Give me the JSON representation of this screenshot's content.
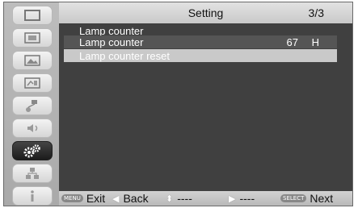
{
  "header": {
    "title": "Setting",
    "page": "3/3"
  },
  "content": {
    "section_label": "Lamp counter",
    "counter_label": "Lamp counter",
    "counter_value": "67",
    "counter_unit": "H",
    "reset_label": "Lamp counter reset"
  },
  "sidebar": {
    "items": [
      {
        "icon": "monitor-icon"
      },
      {
        "icon": "pc-adjust-icon"
      },
      {
        "icon": "image-select-icon"
      },
      {
        "icon": "image-adjust-icon"
      },
      {
        "icon": "screen-icon"
      },
      {
        "icon": "sound-icon"
      },
      {
        "icon": "setting-gears-icon",
        "active": true
      },
      {
        "icon": "network-icon"
      },
      {
        "icon": "information-icon"
      }
    ]
  },
  "guide": {
    "menu_badge": "MENU",
    "exit_label": "Exit",
    "back_label": "Back",
    "updown_label": "----",
    "right_label": "----",
    "select_badge": "SELECT",
    "next_label": "Next"
  },
  "colors": {
    "panel": "#404040",
    "highlight": "#c9c9c9",
    "sidebar_active": "#1c1c1c"
  }
}
